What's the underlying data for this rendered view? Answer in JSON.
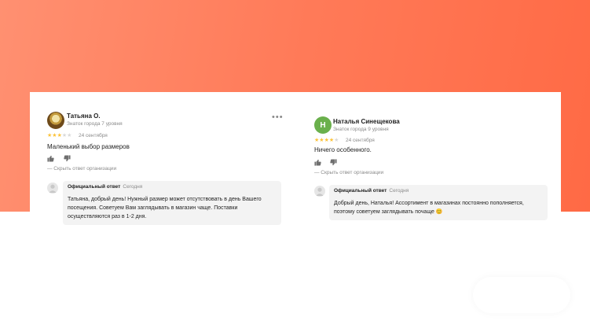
{
  "colors": {
    "accent": "#ff7a58",
    "star_active": "#fcc33b",
    "star_inactive": "#d9d9d9",
    "avatar_letter_bg": "#6ab04c"
  },
  "reviews": [
    {
      "author": "Татьяна О.",
      "badge": "Знаток города 7 уровня",
      "rating": 3,
      "date": "24 сентября",
      "text": "Маленький выбор размеров",
      "hide_reply": "— Скрыть ответ организации",
      "reply": {
        "title": "Официальный ответ",
        "when": "Сегодня",
        "lines": [
          "Татьяна, добрый день! Нужный размер может отсутствовать в день Вашего",
          "посещения. Советуем Вам заглядывать в магазин чаще. Поставки",
          "осуществляются раз в 1-2 дня."
        ]
      }
    },
    {
      "author": "Наталья Синещекова",
      "avatar_letter": "Н",
      "badge": "Знаток города 9 уровня",
      "rating": 4,
      "date": "24 сентября",
      "text": "Ничего особенного.",
      "hide_reply": "— Скрыть ответ организации",
      "reply": {
        "title": "Официальный ответ",
        "when": "Сегодня",
        "lines": [
          "Добрый день, Наталья! Ассортимент в магазинах постоянно пополняется,",
          "поэтому советуем заглядывать почаще 😊"
        ]
      }
    }
  ],
  "icons": {
    "like": "thumb-up-icon",
    "dislike": "thumb-down-icon",
    "menu": "more-icon"
  }
}
